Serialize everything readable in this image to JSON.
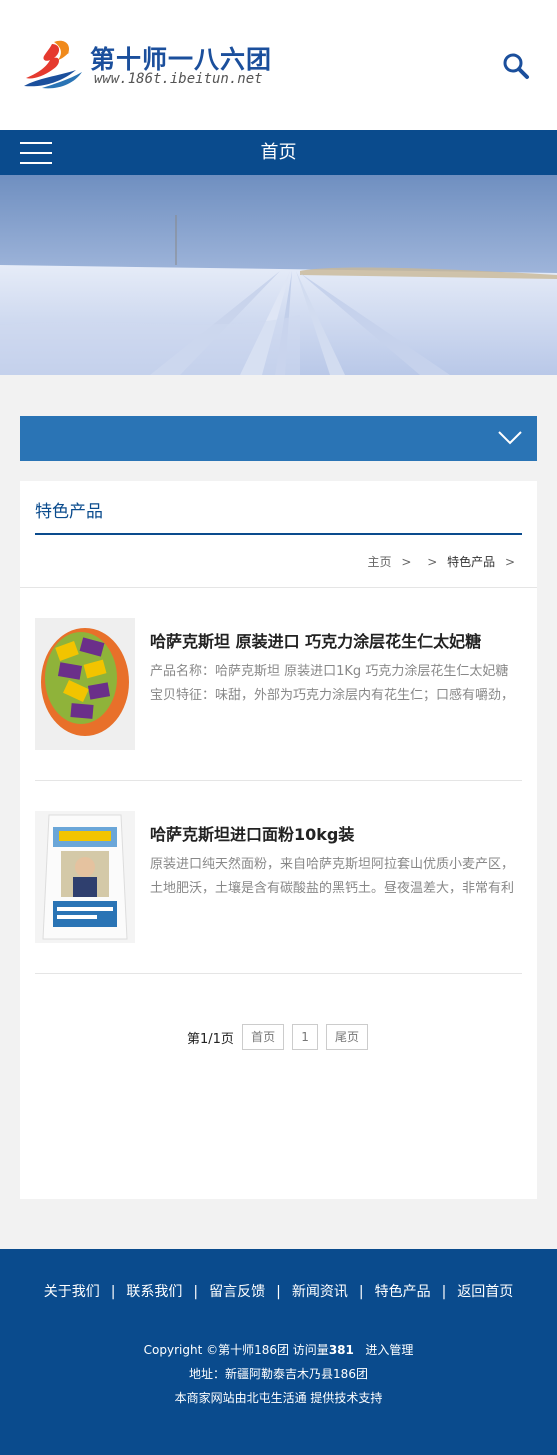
{
  "header": {
    "logo_title": "第十师一八六团",
    "logo_url": "www.186t.ibeitun.net",
    "search_icon": "search-icon"
  },
  "nav": {
    "menu_icon": "hamburger-menu-icon",
    "title": "首页"
  },
  "dropdown": {
    "icon": "chevron-down-icon"
  },
  "panel": {
    "title": "特色产品",
    "breadcrumb": {
      "home": "主页",
      "sep1": ">",
      "sep2": ">",
      "current": "特色产品",
      "sep3": ">"
    }
  },
  "products": [
    {
      "name": "哈萨克斯坦 原装进口 巧克力涂层花生仁太妃糖",
      "desc": "产品名称：哈萨克斯坦 原装进口1Kg 巧克力涂层花生仁太妃糖宝贝特征：味甜，外部为巧克力涂层内有花生仁；口感有嚼劲，类"
    },
    {
      "name": "哈萨克斯坦进口面粉10kg装",
      "desc": "原装进口纯天然面粉，来自哈萨克斯坦阿拉套山优质小麦产区，土地肥沃，土壤是含有碳酸盐的黑钙土。昼夜温差大，非常有利"
    }
  ],
  "pager": {
    "info": "第1/1页",
    "first": "首页",
    "page": "1",
    "last": "尾页"
  },
  "footer": {
    "nav": [
      "关于我们",
      "联系我们",
      "留言反馈",
      "新闻资讯",
      "特色产品",
      "返回首页"
    ],
    "separator": "|",
    "copyright_prefix": "Copyright ©第十师186团 访问量",
    "visits": "381",
    "admin_link": "进入管理",
    "address": "地址：新疆阿勒泰吉木乃县186团",
    "support": "本商家网站由北屯生活通   提供技术支持"
  },
  "colors": {
    "primary": "#0a4b8d",
    "dropdown": "#2a74b5",
    "background": "#f2f2f2"
  }
}
